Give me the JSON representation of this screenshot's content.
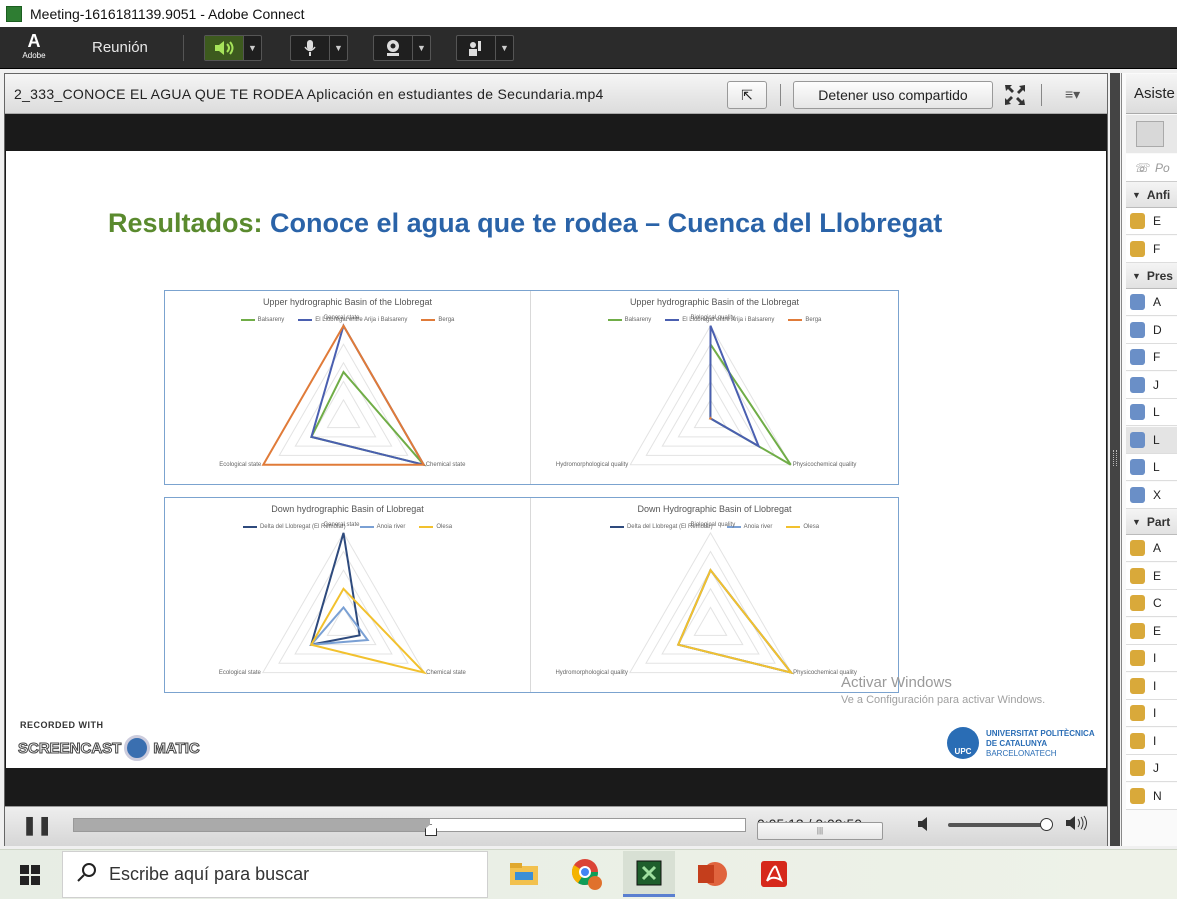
{
  "window": {
    "title": "Meeting-1616181139.9051 - Adobe Connect"
  },
  "toolbar": {
    "brand": "Adobe",
    "meeting_menu": "Reunión"
  },
  "share_pod": {
    "file_title": "2_333_CONOCE EL AGUA QUE TE RODEA Aplicación en estudiantes de Secundaria.mp4",
    "stop_sharing_label": "Detener uso compartido"
  },
  "slide": {
    "title_green": "Resultados:",
    "title_blue": "Conoce el agua que te rodea – Cuenca del Llobregat",
    "watermark_recorded": "RECORDED WITH",
    "watermark_brand_left": "SCREENCAST",
    "watermark_brand_right": "MATIC",
    "upc_line1": "UNIVERSITAT POLITÈCNICA",
    "upc_line2": "DE CATALUNYA",
    "upc_line3": "BARCELONATECH",
    "upc_badge": "UPC"
  },
  "chart_data": [
    {
      "type": "radar",
      "title": "Upper hydrographic Basin of the Llobregat",
      "categories": [
        "General state",
        "Chemical state",
        "Ecological state"
      ],
      "series": [
        {
          "name": "Balsareny",
          "color": "#70ad47",
          "values": [
            0.5,
            1.0,
            0.4
          ]
        },
        {
          "name": "El Llobregat entre Arija i Balsareny",
          "color": "#4a5fb0",
          "values": [
            1.0,
            1.0,
            0.4
          ]
        },
        {
          "name": "Berga",
          "color": "#e07b39",
          "values": [
            1.0,
            1.0,
            1.0
          ]
        }
      ]
    },
    {
      "type": "radar",
      "title": "Upper hydrographic Basin of the Llobregat",
      "categories": [
        "Biological quality",
        "Physicochemical quality",
        "Hydromorphological quality"
      ],
      "series": [
        {
          "name": "Balsareny",
          "color": "#70ad47",
          "values": [
            0.8,
            1.0,
            0.0
          ]
        },
        {
          "name": "El Llobregat entre Arija i Balsareny",
          "color": "#4a5fb0",
          "values": [
            1.0,
            0.6,
            0.0
          ]
        },
        {
          "name": "Berga",
          "color": "#e07b39",
          "values": [
            0.0,
            0.0,
            0.0
          ]
        }
      ]
    },
    {
      "type": "radar",
      "title": "Down hydrographic Basin of Llobregat",
      "categories": [
        "General state",
        "Chemical state",
        "Ecological state"
      ],
      "series": [
        {
          "name": "Delta del Llobregat (El Remolar)",
          "color": "#2e4a7d",
          "values": [
            1.0,
            0.2,
            0.4
          ]
        },
        {
          "name": "Anoia river",
          "color": "#7aa0d4",
          "values": [
            0.2,
            0.3,
            0.4
          ]
        },
        {
          "name": "Olesa",
          "color": "#f2c12e",
          "values": [
            0.4,
            1.0,
            0.4
          ]
        }
      ]
    },
    {
      "type": "radar",
      "title": "Down Hydrographic Basin of Llobregat",
      "categories": [
        "Biological quality",
        "Physicochemical quality",
        "Hydromorphological quality"
      ],
      "series": [
        {
          "name": "Delta del Llobregat (El Remolar)",
          "color": "#2e4a7d",
          "values": [
            0.6,
            1.0,
            0.4
          ]
        },
        {
          "name": "Anoia river",
          "color": "#7aa0d4",
          "values": [
            0.6,
            1.0,
            0.4
          ]
        },
        {
          "name": "Olesa",
          "color": "#f2c12e",
          "values": [
            0.6,
            1.0,
            0.4
          ]
        }
      ]
    }
  ],
  "overlay": {
    "activate_title": "Activar Windows",
    "activate_sub": "Ve a Configuración para activar Windows."
  },
  "player": {
    "time": "0:05:13 / 0:09:50",
    "progress": 0.53,
    "volume": 0.96
  },
  "attendees": {
    "header": "Asiste",
    "search_placeholder": "Po",
    "sections": [
      {
        "label": "Anfi",
        "rows": [
          "E",
          "F"
        ]
      },
      {
        "label": "Pres",
        "rows": [
          "A",
          "D",
          "F",
          "J",
          "L",
          "L",
          "L",
          "X"
        ]
      },
      {
        "label": "Part",
        "rows": [
          "A",
          "E",
          "C",
          "E",
          "I",
          "I",
          "I",
          "I",
          "J",
          "N"
        ]
      }
    ]
  },
  "taskbar": {
    "search_placeholder": "Escribe aquí para buscar"
  }
}
